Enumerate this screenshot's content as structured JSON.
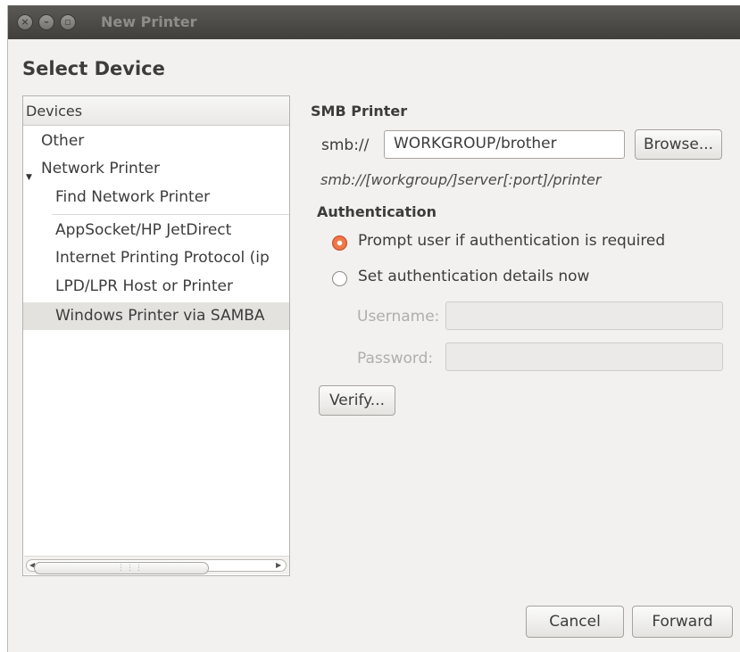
{
  "window": {
    "title": "New Printer",
    "buttons": [
      {
        "name": "close-icon",
        "glyph": "×"
      },
      {
        "name": "minimize-icon",
        "glyph": "–"
      },
      {
        "name": "maximize-icon",
        "glyph": "▫"
      }
    ]
  },
  "page_title": "Select Device",
  "devices": {
    "header": "Devices",
    "items": [
      {
        "label": "Other",
        "level": 0,
        "expander": "",
        "selected": false
      },
      {
        "label": "Network Printer",
        "level": 0,
        "expander": "▼",
        "selected": false
      },
      {
        "label": "Find Network Printer",
        "level": 1,
        "expander": "",
        "selected": false
      },
      {
        "label": "AppSocket/HP JetDirect",
        "level": 1,
        "expander": "",
        "selected": false
      },
      {
        "label": "Internet Printing Protocol (ip",
        "level": 1,
        "expander": "",
        "selected": false
      },
      {
        "label": "LPD/LPR Host or Printer",
        "level": 1,
        "expander": "",
        "selected": false
      },
      {
        "label": "Windows Printer via SAMBA",
        "level": 1,
        "expander": "",
        "selected": true
      }
    ],
    "scroll_grip": "⋮⋮⋮"
  },
  "smb": {
    "section_title": "SMB Printer",
    "prefix_label": "smb://",
    "uri_value": "WORKGROUP/brother",
    "browse_label": "Browse...",
    "hint": "smb://[workgroup/]server[:port]/printer"
  },
  "auth": {
    "section_title": "Authentication",
    "prompt_label": "Prompt user if authentication is required",
    "set_now_label": "Set authentication details now",
    "selected": "prompt",
    "username_label": "Username:",
    "username_value": "",
    "password_label": "Password:",
    "password_value": "",
    "verify_label": "Verify..."
  },
  "footer": {
    "cancel_label": "Cancel",
    "forward_label": "Forward"
  },
  "colors": {
    "radio_accent": "#f07746",
    "titlebar": "#4a4945",
    "window_bg": "#f2f1f0",
    "selection": "#e3e2df"
  }
}
